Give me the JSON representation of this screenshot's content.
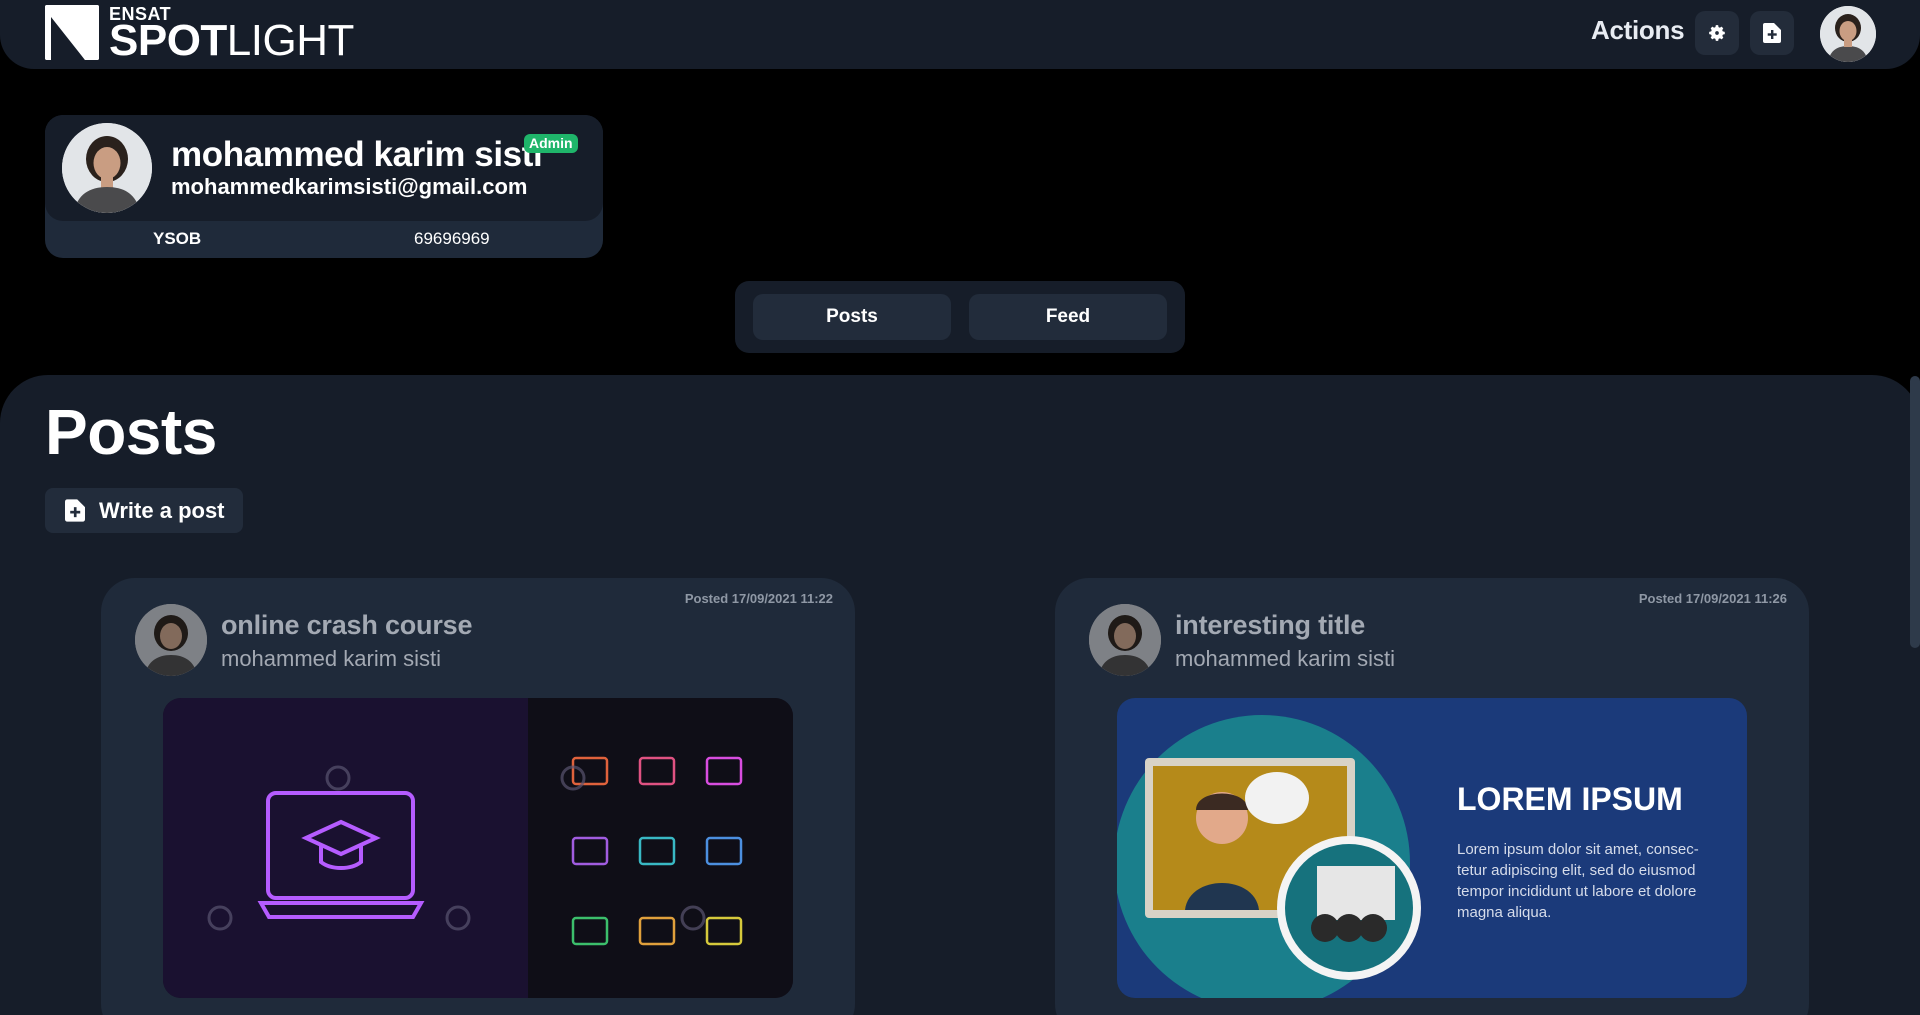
{
  "brand": {
    "small": "ENSAT",
    "big_bold": "SPOT",
    "big_light": "LIGHT"
  },
  "header": {
    "actions_label": "Actions",
    "settings_icon": "gear-icon",
    "newpost_icon": "file-plus-icon"
  },
  "profile": {
    "name": "mohammed karim sisti",
    "badge": "Admin",
    "email": "mohammedkarimsisti@gmail.com",
    "stat_left": "YSOB",
    "stat_right": "69696969"
  },
  "tabs": [
    {
      "label": "Posts"
    },
    {
      "label": "Feed"
    }
  ],
  "main": {
    "heading": "Posts",
    "write_button": "Write a post"
  },
  "posts": [
    {
      "date": "Posted 17/09/2021 11:22",
      "title": "online crash course",
      "author": "mohammed karim sisti",
      "image": "neon-graduation-laptop-icons"
    },
    {
      "date": "Posted 17/09/2021 11:26",
      "title": "interesting title",
      "author": "mohammed karim sisti",
      "image": "online-support-illustration",
      "image_heading": "LOREM IPSUM",
      "image_text_lines": [
        "Lorem ipsum dolor sit amet, consec-",
        "tetur adipiscing elit, sed do eiusmod",
        "tempor incididunt ut labore et dolore",
        "magna aliqua."
      ]
    }
  ],
  "colors": {
    "background": "#000000",
    "panel": "#161d29",
    "card": "#1f2a3a",
    "button": "#222c3b",
    "badge": "#1fb56a"
  }
}
